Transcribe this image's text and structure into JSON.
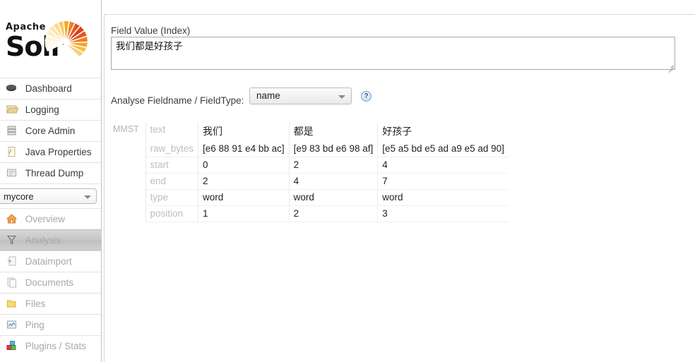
{
  "branding": {
    "apache_label": "Apache",
    "product_label": "Solr",
    "logo_icon": "solr-sunburst-logo"
  },
  "sidebar": {
    "global_items": [
      {
        "label": "Dashboard",
        "icon": "dashboard-icon",
        "active": false
      },
      {
        "label": "Logging",
        "icon": "logging-icon",
        "active": false
      },
      {
        "label": "Core Admin",
        "icon": "core-admin-icon",
        "active": false
      },
      {
        "label": "Java Properties",
        "icon": "java-properties-icon",
        "active": false
      },
      {
        "label": "Thread Dump",
        "icon": "thread-dump-icon",
        "active": false
      }
    ],
    "core_selector": {
      "value": "mycore",
      "caret_icon": "chevron-down-icon"
    },
    "core_items": [
      {
        "label": "Overview",
        "icon": "overview-home-icon",
        "active": false
      },
      {
        "label": "Analysis",
        "icon": "analysis-funnel-icon",
        "active": true
      },
      {
        "label": "Dataimport",
        "icon": "dataimport-icon",
        "active": false
      },
      {
        "label": "Documents",
        "icon": "documents-icon",
        "active": false
      },
      {
        "label": "Files",
        "icon": "files-folder-icon",
        "active": false
      },
      {
        "label": "Ping",
        "icon": "ping-chart-icon",
        "active": false
      },
      {
        "label": "Plugins / Stats",
        "icon": "plugins-stats-icon",
        "active": false
      }
    ]
  },
  "main": {
    "field_value": {
      "label": "Field Value (Index)",
      "value": "我们都是好孩子",
      "placeholder": ""
    },
    "analyse": {
      "label": "Analyse Fieldname / FieldType:",
      "selected": "name",
      "caret_icon": "chevron-down-icon",
      "help_icon": "help-question-icon",
      "help_glyph": "?"
    },
    "analysis": {
      "analyzer": "MMST",
      "row_labels": [
        "text",
        "raw_bytes",
        "start",
        "end",
        "type",
        "position"
      ],
      "tokens": [
        {
          "text": "我们",
          "raw_bytes": "[e6 88 91 e4 bb ac]",
          "start": "0",
          "end": "2",
          "type": "word",
          "position": "1"
        },
        {
          "text": "都是",
          "raw_bytes": "[e9 83 bd e6 98 af]",
          "start": "2",
          "end": "4",
          "type": "word",
          "position": "2"
        },
        {
          "text": "好孩子",
          "raw_bytes": "[e5 a5 bd e5 ad a9 e5 ad 90]",
          "start": "4",
          "end": "7",
          "type": "word",
          "position": "3"
        }
      ]
    }
  },
  "colors": {
    "accent": "#d9411e",
    "sidebar_border": "#c0c0c0",
    "muted_text": "#bdbdbd",
    "help_blue": "#2a6099"
  }
}
